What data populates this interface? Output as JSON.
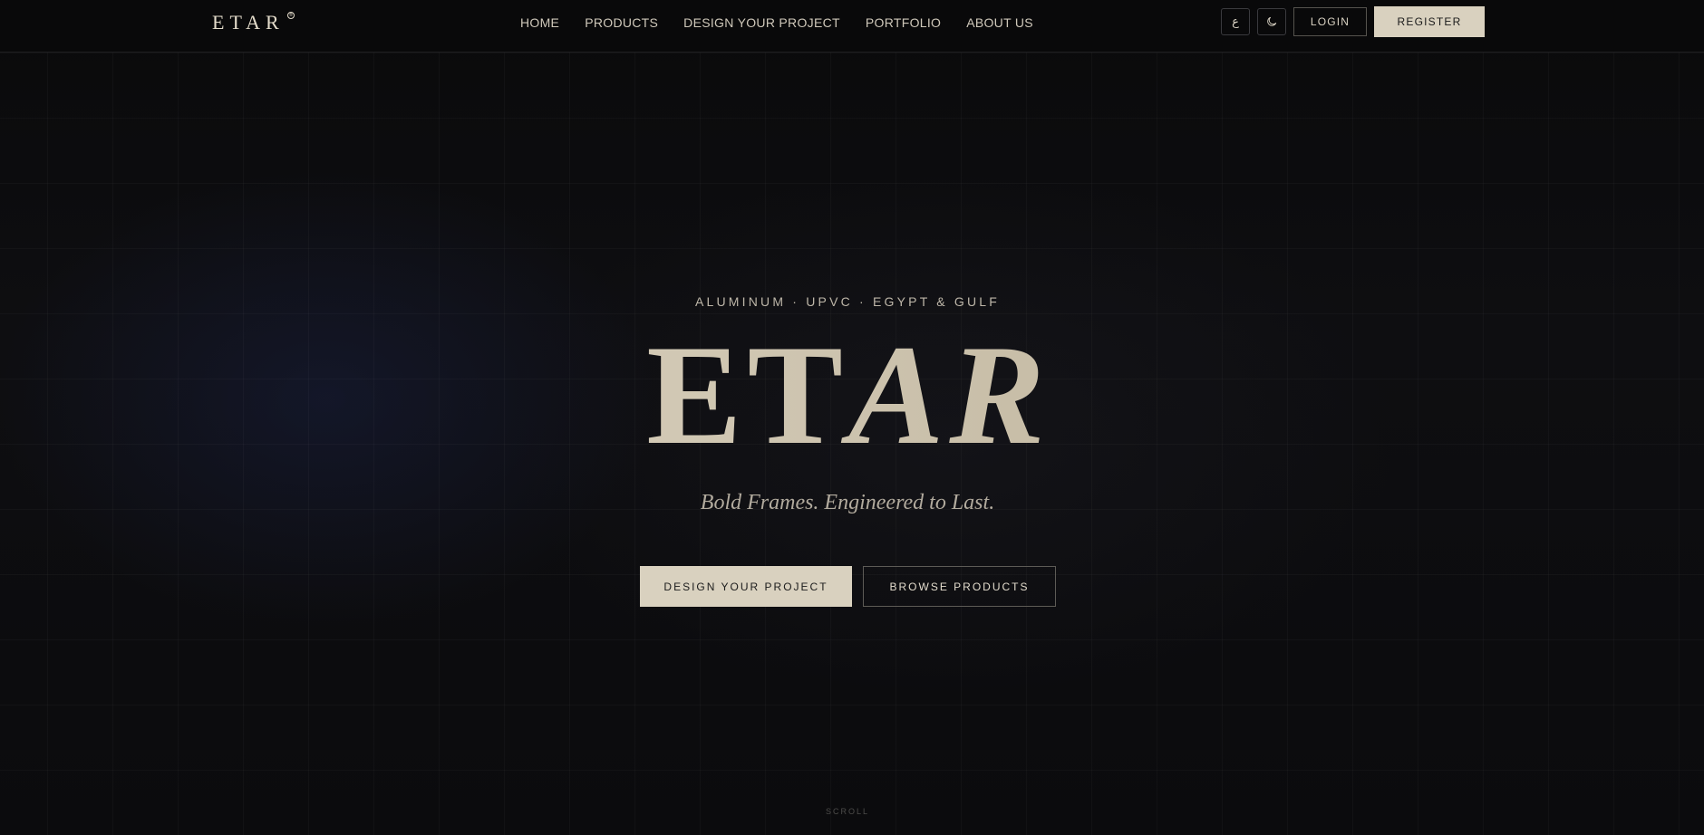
{
  "header": {
    "logo_text": "ETAR",
    "logo_reg": "®",
    "nav": [
      {
        "label": "HOME"
      },
      {
        "label": "PRODUCTS"
      },
      {
        "label": "DESIGN YOUR PROJECT"
      },
      {
        "label": "PORTFOLIO"
      },
      {
        "label": "ABOUT US"
      }
    ],
    "language_toggle": "ع",
    "theme_toggle_icon": "moon-icon",
    "login_label": "LOGIN",
    "register_label": "REGISTER"
  },
  "hero": {
    "eyebrow": "ALUMINUM · UPVC · EGYPT & GULF",
    "title_upright": "ET",
    "title_italic": "AR",
    "tagline": "Bold Frames. Engineered to Last.",
    "primary_cta": "DESIGN YOUR PROJECT",
    "secondary_cta": "BROWSE PRODUCTS",
    "scroll_label": "SCROLL"
  },
  "colors": {
    "background": "#0b0b0d",
    "accent": "#d9d1bf",
    "text": "#d8d1c2"
  }
}
